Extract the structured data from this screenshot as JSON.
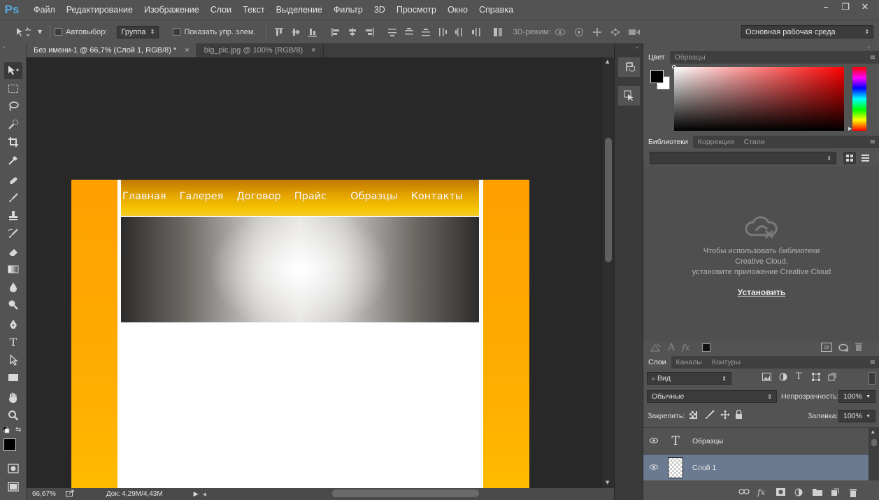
{
  "app": {
    "logo": "Ps"
  },
  "menu": [
    "Файл",
    "Редактирование",
    "Изображение",
    "Слои",
    "Текст",
    "Выделение",
    "Фильтр",
    "3D",
    "Просмотр",
    "Окно",
    "Справка"
  ],
  "window_controls": {
    "minimize": "–",
    "restore": "❐",
    "close": "✕"
  },
  "options": {
    "autoselect_label": "Автовыбор:",
    "autoselect_value": "Группа",
    "show_controls_label": "Показать упр. элем.",
    "mode3d_label": "3D-режим:",
    "workspace": "Основная рабочая среда"
  },
  "tabs": [
    {
      "title": "Без имени-1 @ 66,7% (Слой 1, RGB/8) *",
      "close": "×"
    },
    {
      "title": "big_pic.jpg @ 100% (RGB/8)",
      "close": "×"
    }
  ],
  "document": {
    "nav_links": [
      "Главная",
      "Галерея",
      "Договор",
      "Прайс",
      "Образцы",
      "Контакты"
    ]
  },
  "status": {
    "zoom": "66,67%",
    "doc_info": "Док: 4,29M/4,43M"
  },
  "panels": {
    "color_tabs": [
      "Цвет",
      "Образцы"
    ],
    "library_tabs": [
      "Библиотеки",
      "Коррекция",
      "Стили"
    ],
    "cc_message_1": "Чтобы использовать библиотеки",
    "cc_message_2": "Creative Cloud,",
    "cc_message_3": "установите приложение Creative Cloud",
    "install_label": "Установить",
    "layers_tabs": [
      "Слои",
      "Каналы",
      "Контуры"
    ],
    "filter_kind": "Вид",
    "blend_mode": "Обычные",
    "opacity_label": "Непрозрачность:",
    "opacity_value": "100%",
    "lock_label": "Закрепить:",
    "fill_label": "Заливка:",
    "fill_value": "100%",
    "layers": [
      {
        "name": "Образцы",
        "type": "text"
      },
      {
        "name": "Слой 1",
        "type": "pixel"
      }
    ]
  },
  "colors": {
    "accent_orange": "#ffa500",
    "selected_layer": "#6a7a90",
    "ps_blue": "#57a9e0"
  }
}
